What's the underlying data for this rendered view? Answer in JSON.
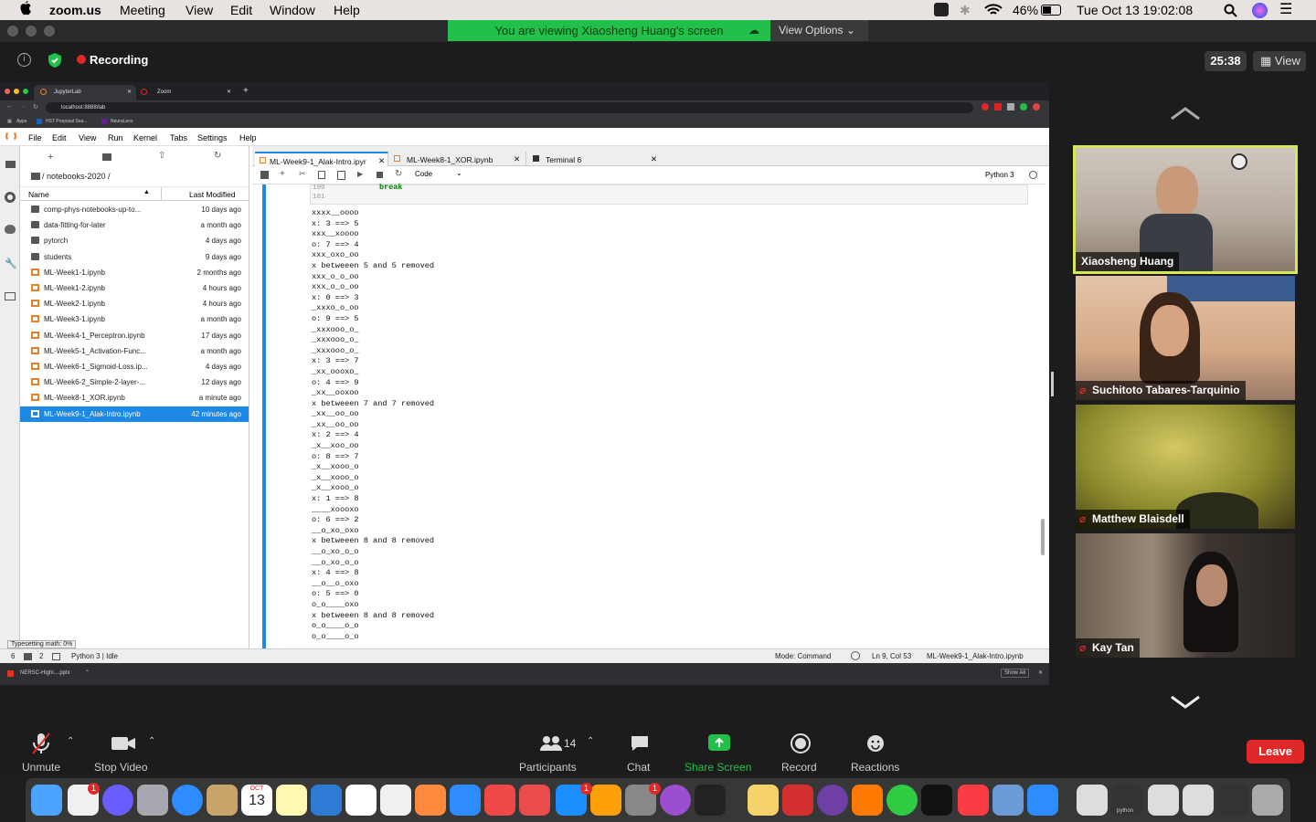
{
  "menubar": {
    "app": "zoom.us",
    "items": [
      "Meeting",
      "View",
      "Edit",
      "Window",
      "Help"
    ],
    "battery": "46%",
    "clock": "Tue Oct 13  19:02:08"
  },
  "zoom": {
    "banner": "You are viewing Xiaosheng Huang's screen",
    "view_options": "View Options",
    "recording": "Recording",
    "timer": "25:38",
    "view": "View"
  },
  "browser": {
    "tabs": [
      "JupyterLab",
      "Zoom"
    ],
    "url": "localhost:8888/lab",
    "bookmarks": [
      "Apps",
      "HST Proposal Sea...",
      "NeuraLens"
    ]
  },
  "jupyter": {
    "menu": [
      "File",
      "Edit",
      "View",
      "Run",
      "Kernel",
      "Tabs",
      "Settings",
      "Help"
    ],
    "path": "/ notebooks-2020 /",
    "col_name": "Name",
    "col_modified": "Last Modified",
    "files": [
      {
        "name": "comp-phys-notebooks-up-to...",
        "modified": "10 days ago",
        "type": "folder"
      },
      {
        "name": "data-fitting-for-later",
        "modified": "a month ago",
        "type": "folder"
      },
      {
        "name": "pytorch",
        "modified": "4 days ago",
        "type": "folder"
      },
      {
        "name": "students",
        "modified": "9 days ago",
        "type": "folder"
      },
      {
        "name": "ML-Week1-1.ipynb",
        "modified": "2 months ago",
        "type": "nb"
      },
      {
        "name": "ML-Week1-2.ipynb",
        "modified": "4 hours ago",
        "type": "nb"
      },
      {
        "name": "ML-Week2-1.ipynb",
        "modified": "4 hours ago",
        "type": "nb"
      },
      {
        "name": "ML-Week3-1.ipynb",
        "modified": "a month ago",
        "type": "nb"
      },
      {
        "name": "ML-Week4-1_Perceptron.ipynb",
        "modified": "17 days ago",
        "type": "nb"
      },
      {
        "name": "ML-Week5-1_Activation-Func...",
        "modified": "a month ago",
        "type": "nb"
      },
      {
        "name": "ML-Week6-1_Sigmoid-Loss.ip...",
        "modified": "4 days ago",
        "type": "nb"
      },
      {
        "name": "ML-Week6-2_Simple-2-layer-...",
        "modified": "12 days ago",
        "type": "nb"
      },
      {
        "name": "ML-Week8-1_XOR.ipynb",
        "modified": "a minute ago",
        "type": "nb"
      },
      {
        "name": "ML-Week9-1_Alak-Intro.ipynb",
        "modified": "42 minutes ago",
        "type": "nb",
        "selected": true
      }
    ],
    "tabs": [
      "ML-Week9-1_Alak-Intro.ipyr",
      "ML-Week8-1_XOR.ipynb",
      "Terminal 6"
    ],
    "celltype": "Code",
    "kernel": "Python 3",
    "line_nums": [
      "100",
      "101"
    ],
    "code_kw": "break",
    "output": [
      "xxxx__oooo",
      "x: 3 ==> 5",
      "xxx__xoooo",
      "o: 7 ==> 4",
      "xxx_oxo_oo",
      "x betweeen 5 and 5 removed",
      "xxx_o_o_oo",
      "xxx_o_o_oo",
      "x: 0 ==> 3",
      "_xxxo_o_oo",
      "o: 9 ==> 5",
      "_xxxooo_o_",
      "_xxxooo_o_",
      "_xxxooo_o_",
      "x: 3 ==> 7",
      "_xx_oooxo_",
      "o: 4 ==> 9",
      "_xx__ooxoo",
      "x betweeen 7 and 7 removed",
      "_xx__oo_oo",
      "_xx__oo_oo",
      "x: 2 ==> 4",
      "_x__xoo_oo",
      "o: 8 ==> 7",
      "_x__xooo_o",
      "_x__xooo_o",
      "_x__xooo_o",
      "x: 1 ==> 8",
      "____xoooxo",
      "o: 6 ==> 2",
      "__o_xo_oxo",
      "x betweeen 8 and 8 removed",
      "__o_xo_o_o",
      "__o_xo_o_o",
      "x: 4 ==> 8",
      "__o__o_oxo",
      "o: 5 ==> 0",
      "o_o____oxo",
      "x betweeen 8 and 8 removed",
      "o_o____o_o",
      "o_o____o_o"
    ],
    "status": {
      "typeset": "Typesetting math: 0%",
      "left1": "6",
      "left2": "2",
      "kernel_state": "Python 3 | Idle",
      "mode": "Mode: Command",
      "pos": "Ln 9, Col 53",
      "file": "ML-Week9-1_Alak-Intro.ipynb"
    },
    "download": "NERSC-Highl....pptx",
    "show_all": "Show All"
  },
  "participants": [
    {
      "name": "Xiaosheng Huang",
      "active": true
    },
    {
      "name": "Suchitoto Tabares-Tarquinio",
      "muted": true
    },
    {
      "name": "Matthew Blaisdell",
      "muted": true
    },
    {
      "name": "Kay Tan",
      "muted": true
    }
  ],
  "toolbar": {
    "unmute": "Unmute",
    "stop_video": "Stop Video",
    "participants": "Participants",
    "participant_count": "14",
    "chat": "Chat",
    "share": "Share Screen",
    "record": "Record",
    "reactions": "Reactions",
    "leave": "Leave"
  },
  "dock": {
    "calendar_month": "OCT",
    "calendar_day": "13",
    "badge1": "1",
    "badge2": "1",
    "badge3": "1",
    "terminal_label": "python"
  },
  "colors": {
    "banner": "#20c04a",
    "accent": "#1e88e5",
    "leave": "#e02828",
    "active_speaker": "#d6e85a"
  }
}
